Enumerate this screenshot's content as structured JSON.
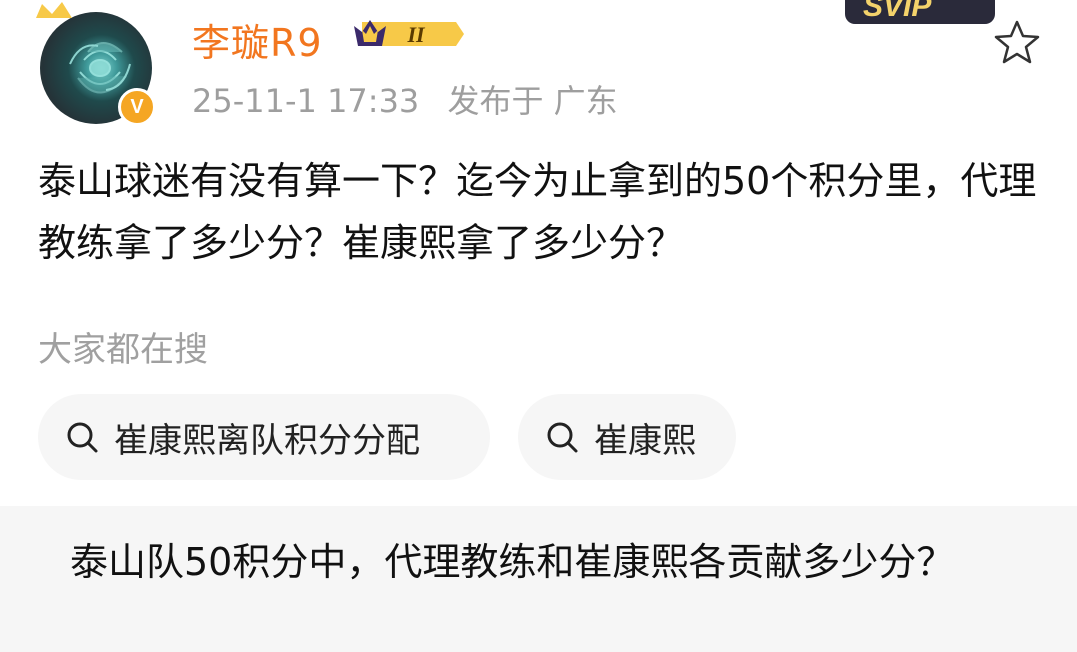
{
  "post": {
    "username": "李璇R9",
    "vip_level": "II",
    "date": "25-11-1 17:33",
    "published": "发布于 广东",
    "verified_badge": "V",
    "top_logo": "SVIP",
    "body": "泰山球迷有没有算一下？迄今为止拿到的50个积分里，代理教练拿了多少分？崔康熙拿了多少分？"
  },
  "search": {
    "label": "大家都在搜",
    "chips": [
      {
        "text": "崔康熙离队积分分配",
        "icon": "search-icon"
      },
      {
        "text": "崔康熙",
        "icon": "search-icon"
      }
    ]
  },
  "summary": {
    "text": "泰山队50积分中，代理教练和崔康熙各贡献多少分？"
  },
  "colors": {
    "username": "#f2761f",
    "meta": "#9e9e9e",
    "verified": "#f5a623",
    "chip_bg": "#f6f6f6"
  }
}
